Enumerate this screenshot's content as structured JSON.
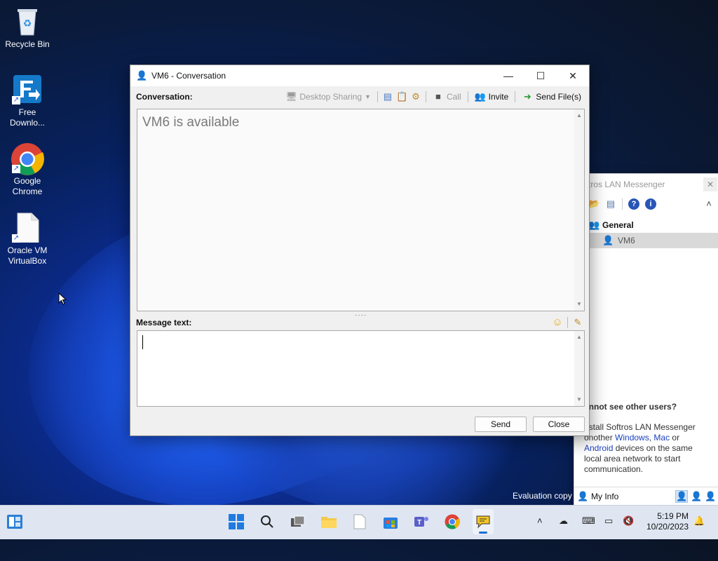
{
  "desktop": {
    "icons": [
      {
        "label": "Recycle Bin",
        "icon": "recycle-bin-icon"
      },
      {
        "label": "Free Downlo...",
        "icon": "free-download-icon"
      },
      {
        "label": "Google Chrome",
        "icon": "chrome-icon"
      },
      {
        "label": "Oracle VM VirtualBox",
        "icon": "file-icon"
      }
    ]
  },
  "conversation": {
    "title": "VM6 - Conversation",
    "toolbar": {
      "label": "Conversation:",
      "desktop_sharing": "Desktop Sharing",
      "call": "Call",
      "invite": "Invite",
      "send_files": "Send File(s)"
    },
    "status_message": "VM6 is available",
    "message_label": "Message text:",
    "message_value": "",
    "send_label": "Send",
    "close_label": "Close"
  },
  "messenger": {
    "title": "oftros LAN Messenger",
    "group": "General",
    "user": "VM6",
    "help_heading": "annot see other users?",
    "help_pre": "nstall Softros LAN Messenger onother ",
    "help_windows": "Windows",
    "help_sep1": ", ",
    "help_mac": "Mac",
    "help_or": " or ",
    "help_android": "Android",
    "help_post": " devices on the same local area network to start communication.",
    "my_info": "My Info"
  },
  "watermark": "Evaluation copy",
  "taskbar": {
    "time": "5:19 PM",
    "date": "10/20/2023"
  },
  "colors": {
    "link": "#1a3fbf",
    "taskbar": "#dfe6f2",
    "selected_row": "#d9d9d9"
  }
}
